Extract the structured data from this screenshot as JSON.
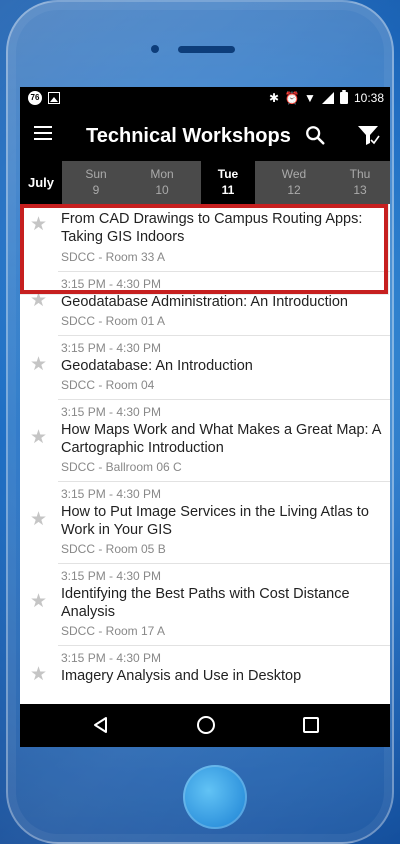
{
  "status_bar": {
    "badge": "76",
    "time": "10:38"
  },
  "app_bar": {
    "title": "Technical Workshops"
  },
  "date_bar": {
    "month": "July",
    "days": [
      {
        "name": "Sun",
        "num": "9"
      },
      {
        "name": "Mon",
        "num": "10"
      },
      {
        "name": "Tue",
        "num": "11"
      },
      {
        "name": "Wed",
        "num": "12"
      },
      {
        "name": "Thu",
        "num": "13"
      }
    ],
    "selected_day": "Tue"
  },
  "sessions": [
    {
      "time": "",
      "title": "From CAD Drawings to Campus Routing Apps: Taking GIS Indoors",
      "venue": "SDCC - Room 33 A",
      "highlighted": true
    },
    {
      "time": "3:15 PM - 4:30 PM",
      "title": "Geodatabase Administration: An Introduction",
      "venue": "SDCC - Room 01 A"
    },
    {
      "time": "3:15 PM - 4:30 PM",
      "title": "Geodatabase: An Introduction",
      "venue": "SDCC - Room 04"
    },
    {
      "time": "3:15 PM - 4:30 PM",
      "title": "How Maps Work and What Makes a Great Map: A Cartographic Introduction",
      "venue": "SDCC - Ballroom 06 C"
    },
    {
      "time": "3:15 PM - 4:30 PM",
      "title": "How to Put Image Services in the Living Atlas to Work in Your GIS",
      "venue": "SDCC - Room 05 B"
    },
    {
      "time": "3:15 PM - 4:30 PM",
      "title": "Identifying the Best Paths with Cost Distance Analysis",
      "venue": "SDCC - Room 17 A"
    },
    {
      "time": "3:15 PM - 4:30 PM",
      "title": "Imagery Analysis and Use in Desktop",
      "venue": ""
    }
  ],
  "colors": {
    "highlight": "#c61f1f",
    "appbar": "#000000",
    "datebar": "#4a4a4a"
  },
  "icons": {
    "menu": "menu-icon",
    "search": "search-icon",
    "filter": "filter-icon",
    "star": "star-icon",
    "back": "back-icon",
    "home": "home-icon",
    "recent": "recent-apps-icon"
  }
}
